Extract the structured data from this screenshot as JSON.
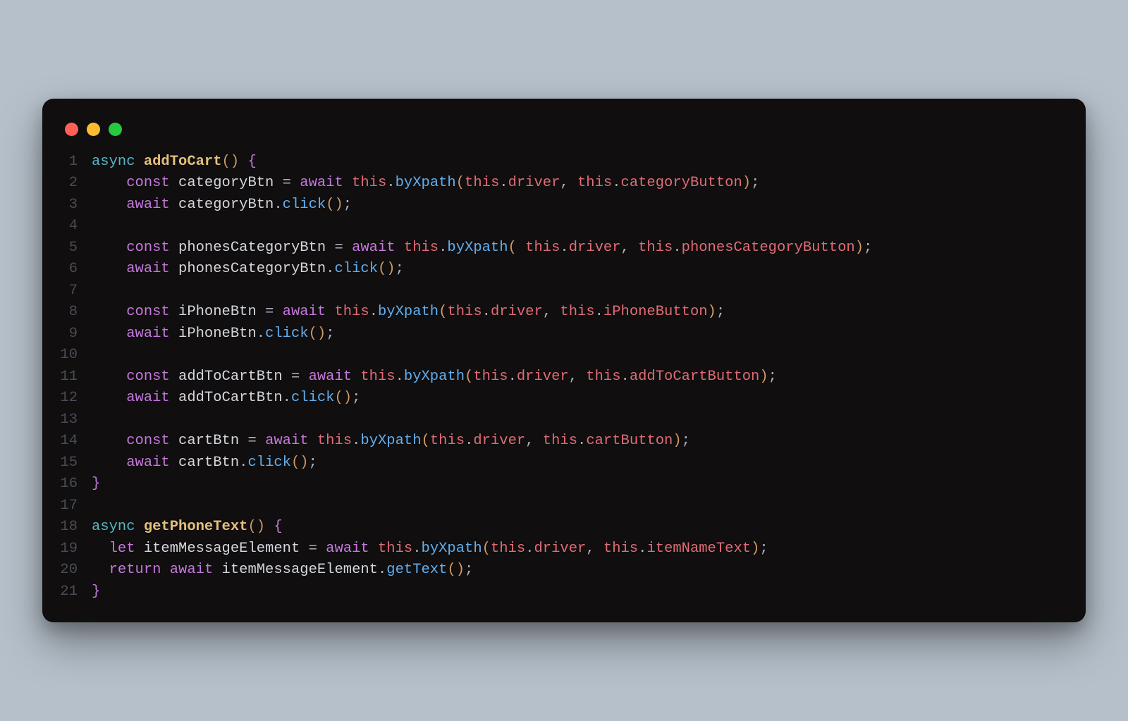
{
  "trafficLights": [
    "red",
    "yellow",
    "green"
  ],
  "code": {
    "lineCount": 21,
    "lines": [
      [
        {
          "t": "async ",
          "c": "kw"
        },
        {
          "t": "addToCart",
          "c": "fnname"
        },
        {
          "t": "()",
          "c": "paren"
        },
        {
          "t": " ",
          "c": "punc"
        },
        {
          "t": "{",
          "c": "brace"
        }
      ],
      [
        {
          "t": "    ",
          "c": "punc"
        },
        {
          "t": "const ",
          "c": "kw2"
        },
        {
          "t": "categoryBtn",
          "c": "ident"
        },
        {
          "t": " = ",
          "c": "punc"
        },
        {
          "t": "await ",
          "c": "kw2"
        },
        {
          "t": "this",
          "c": "this"
        },
        {
          "t": ".",
          "c": "punc"
        },
        {
          "t": "byXpath",
          "c": "fn"
        },
        {
          "t": "(",
          "c": "paren"
        },
        {
          "t": "this",
          "c": "this"
        },
        {
          "t": ".",
          "c": "punc"
        },
        {
          "t": "driver",
          "c": "prop"
        },
        {
          "t": ", ",
          "c": "punc"
        },
        {
          "t": "this",
          "c": "this"
        },
        {
          "t": ".",
          "c": "punc"
        },
        {
          "t": "categoryButton",
          "c": "prop"
        },
        {
          "t": ")",
          "c": "paren"
        },
        {
          "t": ";",
          "c": "punc"
        }
      ],
      [
        {
          "t": "    ",
          "c": "punc"
        },
        {
          "t": "await ",
          "c": "kw2"
        },
        {
          "t": "categoryBtn",
          "c": "ident"
        },
        {
          "t": ".",
          "c": "punc"
        },
        {
          "t": "click",
          "c": "fn"
        },
        {
          "t": "()",
          "c": "paren"
        },
        {
          "t": ";",
          "c": "punc"
        }
      ],
      [],
      [
        {
          "t": "    ",
          "c": "punc"
        },
        {
          "t": "const ",
          "c": "kw2"
        },
        {
          "t": "phonesCategoryBtn",
          "c": "ident"
        },
        {
          "t": " = ",
          "c": "punc"
        },
        {
          "t": "await ",
          "c": "kw2"
        },
        {
          "t": "this",
          "c": "this"
        },
        {
          "t": ".",
          "c": "punc"
        },
        {
          "t": "byXpath",
          "c": "fn"
        },
        {
          "t": "(",
          "c": "paren"
        },
        {
          "t": " ",
          "c": "punc"
        },
        {
          "t": "this",
          "c": "this"
        },
        {
          "t": ".",
          "c": "punc"
        },
        {
          "t": "driver",
          "c": "prop"
        },
        {
          "t": ", ",
          "c": "punc"
        },
        {
          "t": "this",
          "c": "this"
        },
        {
          "t": ".",
          "c": "punc"
        },
        {
          "t": "phonesCategoryButton",
          "c": "prop"
        },
        {
          "t": ")",
          "c": "paren"
        },
        {
          "t": ";",
          "c": "punc"
        }
      ],
      [
        {
          "t": "    ",
          "c": "punc"
        },
        {
          "t": "await ",
          "c": "kw2"
        },
        {
          "t": "phonesCategoryBtn",
          "c": "ident"
        },
        {
          "t": ".",
          "c": "punc"
        },
        {
          "t": "click",
          "c": "fn"
        },
        {
          "t": "()",
          "c": "paren"
        },
        {
          "t": ";",
          "c": "punc"
        }
      ],
      [],
      [
        {
          "t": "    ",
          "c": "punc"
        },
        {
          "t": "const ",
          "c": "kw2"
        },
        {
          "t": "iPhoneBtn",
          "c": "ident"
        },
        {
          "t": " = ",
          "c": "punc"
        },
        {
          "t": "await ",
          "c": "kw2"
        },
        {
          "t": "this",
          "c": "this"
        },
        {
          "t": ".",
          "c": "punc"
        },
        {
          "t": "byXpath",
          "c": "fn"
        },
        {
          "t": "(",
          "c": "paren"
        },
        {
          "t": "this",
          "c": "this"
        },
        {
          "t": ".",
          "c": "punc"
        },
        {
          "t": "driver",
          "c": "prop"
        },
        {
          "t": ", ",
          "c": "punc"
        },
        {
          "t": "this",
          "c": "this"
        },
        {
          "t": ".",
          "c": "punc"
        },
        {
          "t": "iPhoneButton",
          "c": "prop"
        },
        {
          "t": ")",
          "c": "paren"
        },
        {
          "t": ";",
          "c": "punc"
        }
      ],
      [
        {
          "t": "    ",
          "c": "punc"
        },
        {
          "t": "await ",
          "c": "kw2"
        },
        {
          "t": "iPhoneBtn",
          "c": "ident"
        },
        {
          "t": ".",
          "c": "punc"
        },
        {
          "t": "click",
          "c": "fn"
        },
        {
          "t": "()",
          "c": "paren"
        },
        {
          "t": ";",
          "c": "punc"
        }
      ],
      [],
      [
        {
          "t": "    ",
          "c": "punc"
        },
        {
          "t": "const ",
          "c": "kw2"
        },
        {
          "t": "addToCartBtn",
          "c": "ident"
        },
        {
          "t": " = ",
          "c": "punc"
        },
        {
          "t": "await ",
          "c": "kw2"
        },
        {
          "t": "this",
          "c": "this"
        },
        {
          "t": ".",
          "c": "punc"
        },
        {
          "t": "byXpath",
          "c": "fn"
        },
        {
          "t": "(",
          "c": "paren"
        },
        {
          "t": "this",
          "c": "this"
        },
        {
          "t": ".",
          "c": "punc"
        },
        {
          "t": "driver",
          "c": "prop"
        },
        {
          "t": ", ",
          "c": "punc"
        },
        {
          "t": "this",
          "c": "this"
        },
        {
          "t": ".",
          "c": "punc"
        },
        {
          "t": "addToCartButton",
          "c": "prop"
        },
        {
          "t": ")",
          "c": "paren"
        },
        {
          "t": ";",
          "c": "punc"
        }
      ],
      [
        {
          "t": "    ",
          "c": "punc"
        },
        {
          "t": "await ",
          "c": "kw2"
        },
        {
          "t": "addToCartBtn",
          "c": "ident"
        },
        {
          "t": ".",
          "c": "punc"
        },
        {
          "t": "click",
          "c": "fn"
        },
        {
          "t": "()",
          "c": "paren"
        },
        {
          "t": ";",
          "c": "punc"
        }
      ],
      [],
      [
        {
          "t": "    ",
          "c": "punc"
        },
        {
          "t": "const ",
          "c": "kw2"
        },
        {
          "t": "cartBtn",
          "c": "ident"
        },
        {
          "t": " = ",
          "c": "punc"
        },
        {
          "t": "await ",
          "c": "kw2"
        },
        {
          "t": "this",
          "c": "this"
        },
        {
          "t": ".",
          "c": "punc"
        },
        {
          "t": "byXpath",
          "c": "fn"
        },
        {
          "t": "(",
          "c": "paren"
        },
        {
          "t": "this",
          "c": "this"
        },
        {
          "t": ".",
          "c": "punc"
        },
        {
          "t": "driver",
          "c": "prop"
        },
        {
          "t": ", ",
          "c": "punc"
        },
        {
          "t": "this",
          "c": "this"
        },
        {
          "t": ".",
          "c": "punc"
        },
        {
          "t": "cartButton",
          "c": "prop"
        },
        {
          "t": ")",
          "c": "paren"
        },
        {
          "t": ";",
          "c": "punc"
        }
      ],
      [
        {
          "t": "    ",
          "c": "punc"
        },
        {
          "t": "await ",
          "c": "kw2"
        },
        {
          "t": "cartBtn",
          "c": "ident"
        },
        {
          "t": ".",
          "c": "punc"
        },
        {
          "t": "click",
          "c": "fn"
        },
        {
          "t": "()",
          "c": "paren"
        },
        {
          "t": ";",
          "c": "punc"
        }
      ],
      [
        {
          "t": "}",
          "c": "brace"
        }
      ],
      [],
      [
        {
          "t": "async ",
          "c": "kw"
        },
        {
          "t": "getPhoneText",
          "c": "fnname"
        },
        {
          "t": "()",
          "c": "paren"
        },
        {
          "t": " ",
          "c": "punc"
        },
        {
          "t": "{",
          "c": "brace"
        }
      ],
      [
        {
          "t": "  ",
          "c": "punc"
        },
        {
          "t": "let ",
          "c": "kw2"
        },
        {
          "t": "itemMessageElement",
          "c": "ident"
        },
        {
          "t": " = ",
          "c": "punc"
        },
        {
          "t": "await ",
          "c": "kw2"
        },
        {
          "t": "this",
          "c": "this"
        },
        {
          "t": ".",
          "c": "punc"
        },
        {
          "t": "byXpath",
          "c": "fn"
        },
        {
          "t": "(",
          "c": "paren"
        },
        {
          "t": "this",
          "c": "this"
        },
        {
          "t": ".",
          "c": "punc"
        },
        {
          "t": "driver",
          "c": "prop"
        },
        {
          "t": ", ",
          "c": "punc"
        },
        {
          "t": "this",
          "c": "this"
        },
        {
          "t": ".",
          "c": "punc"
        },
        {
          "t": "itemNameText",
          "c": "prop"
        },
        {
          "t": ")",
          "c": "paren"
        },
        {
          "t": ";",
          "c": "punc"
        }
      ],
      [
        {
          "t": "  ",
          "c": "punc"
        },
        {
          "t": "return ",
          "c": "kw2"
        },
        {
          "t": "await ",
          "c": "kw2"
        },
        {
          "t": "itemMessageElement",
          "c": "ident"
        },
        {
          "t": ".",
          "c": "punc"
        },
        {
          "t": "getText",
          "c": "fn"
        },
        {
          "t": "()",
          "c": "paren"
        },
        {
          "t": ";",
          "c": "punc"
        }
      ],
      [
        {
          "t": "}",
          "c": "brace"
        }
      ]
    ]
  }
}
